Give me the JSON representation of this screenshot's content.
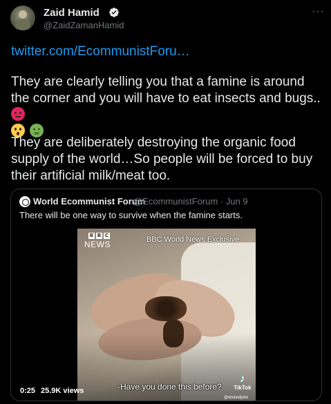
{
  "author": {
    "name": "Zaid Hamid",
    "handle": "@ZaidZamanHamid",
    "verified": true
  },
  "menu": {
    "more_label": "···"
  },
  "tweet": {
    "link_text": "twitter.com/EcommunistForu…",
    "paragraph1": "They are clearly telling you that a famine is around the corner and you will have to eat insects and bugs..",
    "paragraph1_emojis": [
      "angry-face-emoji",
      "astonished-face-emoji",
      "nauseated-face-emoji"
    ],
    "paragraph2": "They are deliberately destroying the organic food supply of the world…So people will be forced to buy their artificial milk/meat too."
  },
  "quoted": {
    "name": "World Ecommunist Forum",
    "handle_date": "@EcommunistForum · Jun 9",
    "text": "There will be one way to survive when the famine starts.",
    "video": {
      "bbc_letters": [
        "B",
        "B",
        "C"
      ],
      "bbc_news": "NEWS",
      "exclusive_label": "BBC World News Exclusive",
      "subtitle": "-Have you done this before?",
      "tiktok_brand": "TikTok",
      "tiktok_user": "@wickedjolie",
      "tiktok_glyph": "♪",
      "timestamp": "0:25",
      "views": "25.9K views"
    }
  },
  "colors": {
    "background": "#000000",
    "text": "#e7e9ea",
    "muted": "#71767b",
    "link": "#1d9bf0",
    "border": "#2f3336"
  }
}
